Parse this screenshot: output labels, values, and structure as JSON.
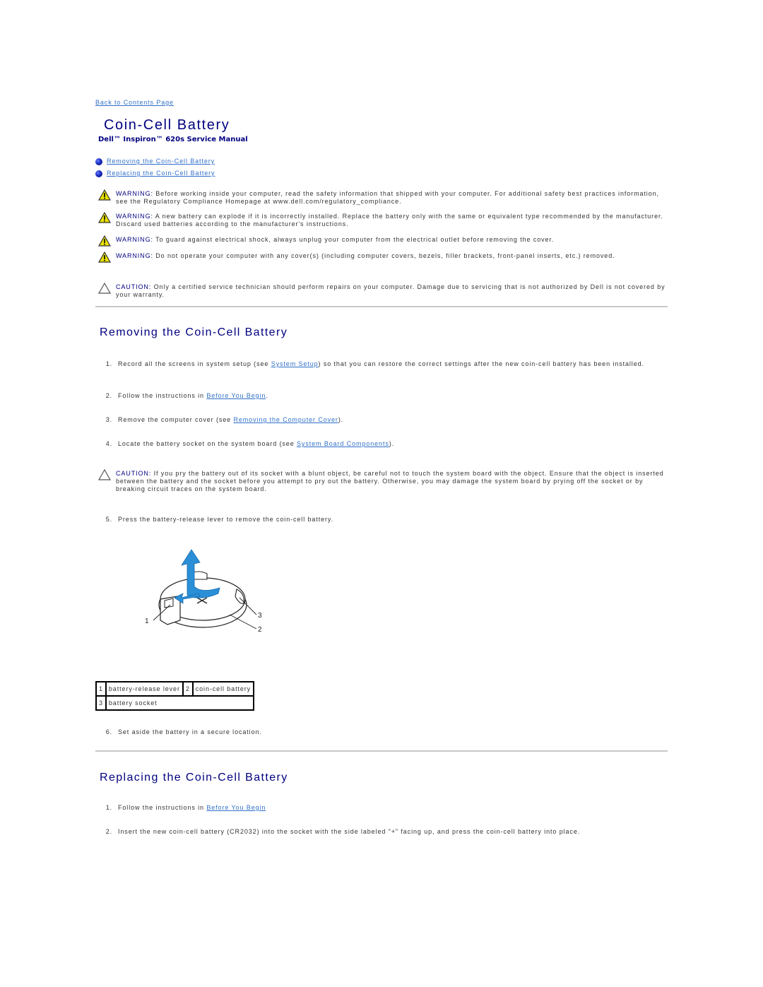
{
  "nav": {
    "back_link": "Back to Contents Page"
  },
  "header": {
    "title": "Coin-Cell Battery",
    "subtitle": "Dell™ Inspiron™ 620s Service Manual"
  },
  "toc": [
    {
      "label": "Removing the Coin-Cell Battery"
    },
    {
      "label": "Replacing the Coin-Cell Battery"
    }
  ],
  "notices": [
    {
      "type": "warning",
      "label": "WARNING:",
      "text": "Before working inside your computer, read the safety information that shipped with your computer. For additional safety best practices information, see the Regulatory Compliance Homepage at www.dell.com/regulatory_compliance."
    },
    {
      "type": "warning",
      "label": "WARNING:",
      "text": "A new battery can explode if it is incorrectly installed. Replace the battery only with the same or equivalent type recommended by the manufacturer. Discard used batteries according to the manufacturer's instructions."
    },
    {
      "type": "warning",
      "label": "WARNING:",
      "text": "To guard against electrical shock, always unplug your computer from the electrical outlet before removing the cover."
    },
    {
      "type": "warning",
      "label": "WARNING:",
      "text": "Do not operate your computer with any cover(s) (including computer covers, bezels, filler brackets, front-panel inserts, etc.) removed."
    },
    {
      "type": "caution",
      "label": "CAUTION:",
      "text": "Only a certified service technician should perform repairs on your computer. Damage due to servicing that is not authorized by Dell is not covered by your warranty."
    }
  ],
  "removing": {
    "heading": "Removing the Coin-Cell Battery",
    "steps": [
      {
        "num": "1.",
        "before": "Record all the screens in system setup (see ",
        "link": "System Setup",
        "after": ") so that you can restore the correct settings after the new coin-cell battery has been installed."
      },
      {
        "num": "2.",
        "before": "Follow the instructions in ",
        "link": "Before You Begin",
        "after": "."
      },
      {
        "num": "3.",
        "before": "Remove the computer cover (see ",
        "link": "Removing the Computer Cover",
        "after": ")."
      },
      {
        "num": "4.",
        "before": "Locate the battery socket on the system board (see ",
        "link": "System Board Components",
        "after": ")."
      }
    ],
    "caution": {
      "label": "CAUTION:",
      "text": "If you pry the battery out of its socket with a blunt object, be careful not to touch the system board with the object. Ensure that the object is inserted between the battery and the socket before you attempt to pry out the battery. Otherwise, you may damage the system board by prying off the socket or by breaking circuit traces on the system board."
    },
    "step5": {
      "num": "5.",
      "text": "Press the battery-release lever to remove the coin-cell battery."
    },
    "figure_callouts": [
      "1",
      "2",
      "3"
    ],
    "legend": [
      {
        "num": "1",
        "label": "battery-release lever"
      },
      {
        "num": "2",
        "label": "coin-cell battery"
      },
      {
        "num": "3",
        "label": "battery socket"
      }
    ],
    "step6": {
      "num": "6.",
      "text": "Set aside the battery in a secure location."
    }
  },
  "replacing": {
    "heading": "Replacing the Coin-Cell Battery",
    "steps": [
      {
        "num": "1.",
        "before": "Follow the instructions in ",
        "link": "Before You Begin",
        "after": ""
      },
      {
        "num": "2.",
        "before": "Insert the new coin-cell battery (CR2032) into the socket with the side labeled \"+\" facing up, and press the coin-cell battery into place.",
        "link": "",
        "after": ""
      }
    ]
  },
  "colors": {
    "heading": "#000080",
    "link": "#2f6fc9",
    "warning_icon": "#e8e000",
    "body_text": "#333333"
  }
}
